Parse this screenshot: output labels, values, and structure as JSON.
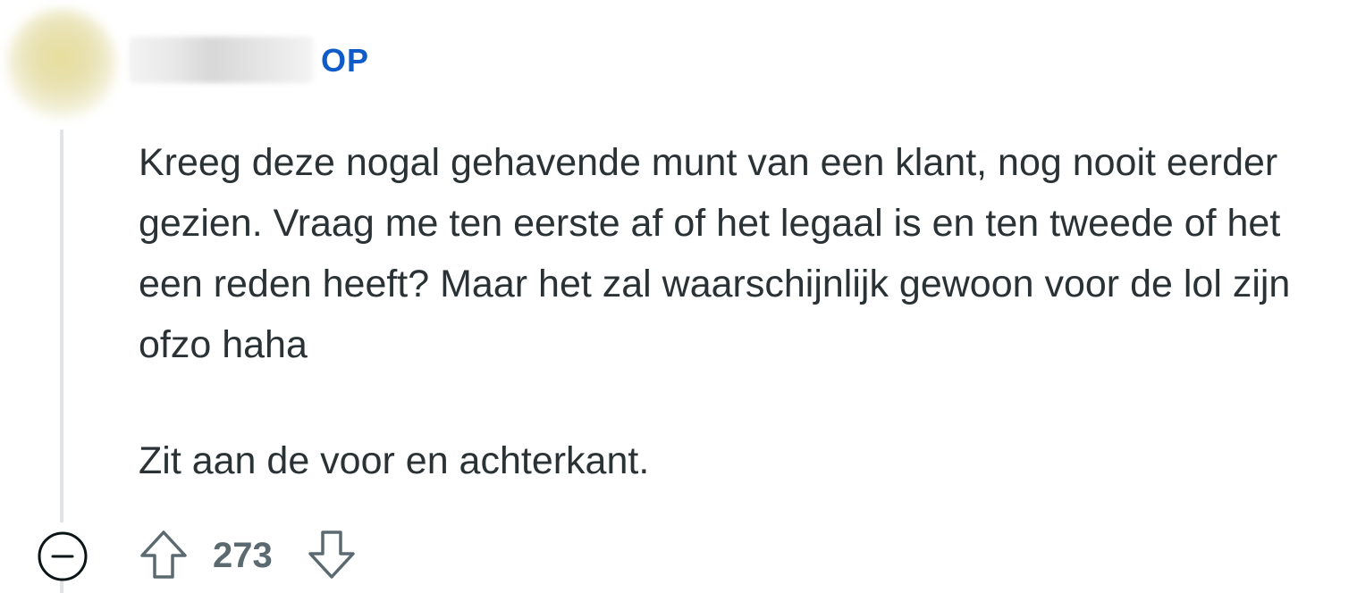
{
  "comment": {
    "author": {
      "username": "",
      "badge": "OP"
    },
    "body": [
      "Kreeg deze nogal gehavende munt van een klant, nog nooit eerder gezien. Vraag me ten eerste af of het legaal is en ten tweede of het een reden heeft? Maar het zal waarschijnlijk gewoon voor de lol zijn ofzo haha",
      "Zit aan de voor en achterkant."
    ],
    "actions": {
      "vote_count": "273",
      "upvote_icon": "upvote-arrow-icon",
      "downvote_icon": "downvote-arrow-icon",
      "collapse_icon": "collapse-minus-icon"
    }
  },
  "colors": {
    "op_badge": "#0f5cc9",
    "body_text": "#2a3236",
    "vote_count": "#5b6970",
    "thread_line": "#e1e5e8"
  }
}
